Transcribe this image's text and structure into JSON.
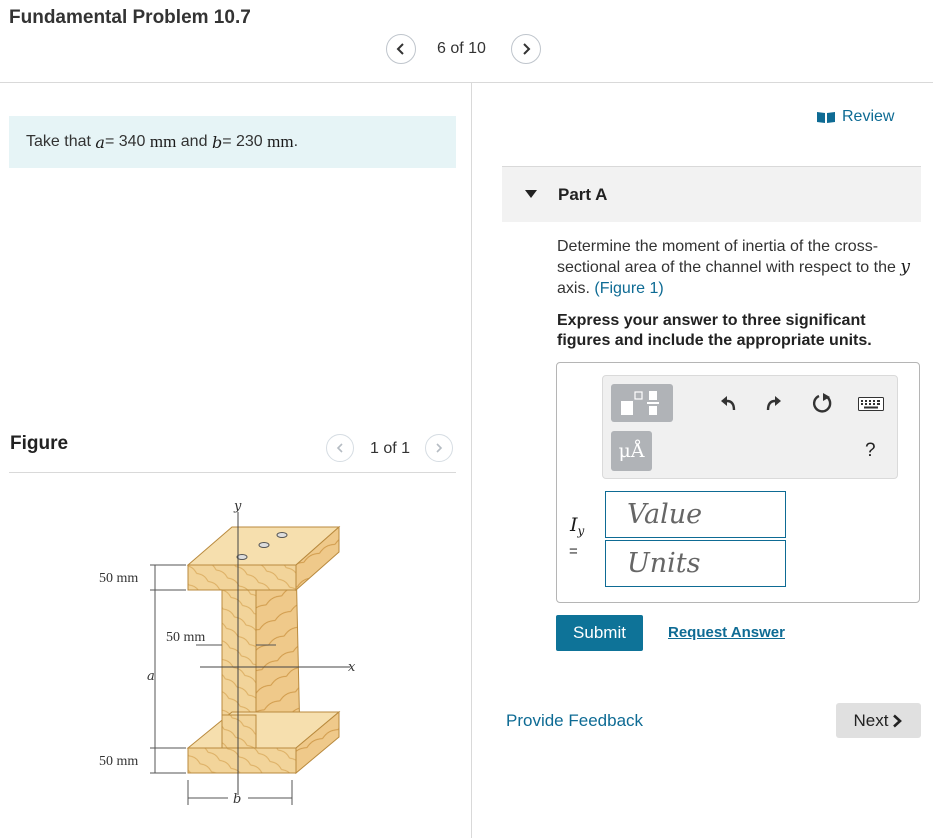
{
  "header": {
    "title": "Fundamental Problem 10.7",
    "pagination": "6 of 10"
  },
  "given": {
    "prefix": "Take that",
    "var_a": "a",
    "eq1": " = 340",
    "unit1": "mm",
    "and": "and",
    "var_b": "b",
    "eq2": " = 230",
    "unit2": "mm",
    "period": "."
  },
  "figure": {
    "label": "Figure",
    "pagination": "1 of 1",
    "dim_top": "50 mm",
    "dim_web": "50 mm",
    "dim_bottom": "50 mm",
    "var_a": "a",
    "var_b": "b",
    "axis_x": "x",
    "axis_y": "y"
  },
  "review": {
    "label": "Review"
  },
  "part": {
    "label": "Part A"
  },
  "question": {
    "text": "Determine the moment of inertia of the cross-sectional area of the channel with respect to the",
    "var": "y",
    "text2": "axis.",
    "link": "(Figure 1)"
  },
  "instructions": "Express your answer to three significant figures and include the appropriate units.",
  "answer": {
    "label_var": "I",
    "label_sub": "y",
    "label_eq": "=",
    "value_placeholder": "Value",
    "units_placeholder": "Units",
    "units_button": "μÅ",
    "help": "?"
  },
  "actions": {
    "submit": "Submit",
    "request_answer": "Request Answer",
    "feedback": "Provide Feedback",
    "next": "Next"
  },
  "colors": {
    "link": "#0e6b94",
    "submit_bg": "#0e7398",
    "given_bg": "#e6f4f6",
    "toolbar_button": "#b0b3b7"
  }
}
